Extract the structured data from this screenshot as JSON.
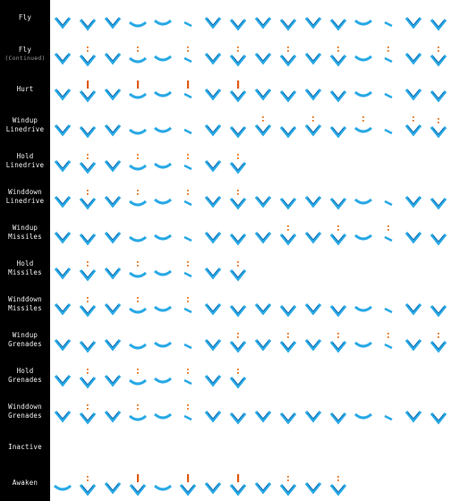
{
  "sheet": {
    "title": ""
  },
  "colors": {
    "sprite": "#29a9e6",
    "sprite_shadow": "#156fb0",
    "missile": "#e8741c",
    "grenade": "#d9a51a",
    "hurt": "#e05a10"
  },
  "rows": [
    {
      "label": [
        "Fly"
      ],
      "frames": 16,
      "shapes": [
        "v",
        "v",
        "v",
        "arc",
        "arc",
        "dash",
        "v",
        "v",
        "v",
        "v",
        "v",
        "v",
        "arc",
        "dash",
        "v",
        "v"
      ],
      "marks": []
    },
    {
      "label": [
        "Fly",
        "(Continued)"
      ],
      "frames": 16,
      "shapes": [
        "v",
        "v",
        "v",
        "arc",
        "arc",
        "dash",
        "v",
        "v",
        "v",
        "v",
        "v",
        "v",
        "arc",
        "dash",
        "v",
        "v"
      ],
      "marks": [
        [
          1,
          "spark"
        ],
        [
          3,
          "spark"
        ],
        [
          5,
          "spark"
        ],
        [
          7,
          "spark"
        ],
        [
          9,
          "spark"
        ],
        [
          11,
          "spark"
        ],
        [
          13,
          "spark"
        ],
        [
          15,
          "spark"
        ]
      ]
    },
    {
      "label": [
        "Hurt"
      ],
      "frames": 16,
      "shapes": [
        "v",
        "v",
        "v",
        "arc",
        "arc",
        "dash",
        "v",
        "v",
        "v",
        "v",
        "v",
        "v",
        "arc",
        "dash",
        "v",
        "v"
      ],
      "marks": [
        [
          1,
          "hurt"
        ],
        [
          3,
          "hurt"
        ],
        [
          5,
          "hurt"
        ],
        [
          7,
          "hurt"
        ]
      ]
    },
    {
      "label": [
        "Windup",
        "Linedrive"
      ],
      "frames": 16,
      "shapes": [
        "v",
        "v",
        "v",
        "arc",
        "arc",
        "dash",
        "v",
        "v",
        "v",
        "v",
        "v",
        "v",
        "arc",
        "dash",
        "v",
        "v"
      ],
      "marks": [
        [
          8,
          "spark"
        ],
        [
          10,
          "spark"
        ],
        [
          12,
          "spark"
        ],
        [
          14,
          "spark"
        ],
        [
          15,
          "spark"
        ]
      ]
    },
    {
      "label": [
        "Hold",
        "Linedrive"
      ],
      "frames": 8,
      "shapes": [
        "v",
        "v",
        "v",
        "arc",
        "arc",
        "dash",
        "v",
        "v"
      ],
      "marks": [
        [
          1,
          "spark"
        ],
        [
          3,
          "spark"
        ],
        [
          5,
          "spark"
        ],
        [
          7,
          "spark"
        ]
      ]
    },
    {
      "label": [
        "Winddown",
        "Linedrive"
      ],
      "frames": 16,
      "shapes": [
        "v",
        "v",
        "v",
        "arc",
        "arc",
        "dash",
        "v",
        "v",
        "v",
        "v",
        "v",
        "v",
        "arc",
        "dash",
        "v",
        "v"
      ],
      "marks": [
        [
          1,
          "spark"
        ],
        [
          3,
          "spark"
        ],
        [
          5,
          "spark"
        ],
        [
          7,
          "spark"
        ]
      ]
    },
    {
      "label": [
        "Windup",
        "Missiles"
      ],
      "frames": 16,
      "shapes": [
        "v",
        "v",
        "v",
        "arc",
        "arc",
        "dash",
        "v",
        "v",
        "v",
        "v",
        "v",
        "v",
        "arc",
        "dash",
        "v",
        "v"
      ],
      "marks": [
        [
          9,
          "spark"
        ],
        [
          11,
          "spark"
        ],
        [
          13,
          "spark"
        ]
      ]
    },
    {
      "label": [
        "Hold",
        "Missiles"
      ],
      "frames": 8,
      "shapes": [
        "v",
        "v",
        "v",
        "arc",
        "arc",
        "dash",
        "v",
        "v"
      ],
      "marks": [
        [
          1,
          "spark"
        ],
        [
          3,
          "spark"
        ],
        [
          5,
          "spark"
        ],
        [
          7,
          "spark"
        ]
      ]
    },
    {
      "label": [
        "Winddown",
        "Missiles"
      ],
      "frames": 16,
      "shapes": [
        "v",
        "v",
        "v",
        "arc",
        "arc",
        "dash",
        "v",
        "v",
        "v",
        "v",
        "v",
        "v",
        "arc",
        "dash",
        "v",
        "v"
      ],
      "marks": [
        [
          1,
          "spark"
        ],
        [
          3,
          "spark"
        ],
        [
          5,
          "spark"
        ]
      ]
    },
    {
      "label": [
        "Windup",
        "Grenades"
      ],
      "frames": 16,
      "shapes": [
        "v",
        "v",
        "v",
        "arc",
        "arc",
        "dash",
        "v",
        "v",
        "v",
        "v",
        "v",
        "v",
        "arc",
        "dash",
        "v",
        "v"
      ],
      "marks": [
        [
          7,
          "spark"
        ],
        [
          9,
          "spark"
        ],
        [
          11,
          "spark"
        ],
        [
          13,
          "spark"
        ],
        [
          15,
          "spark"
        ]
      ]
    },
    {
      "label": [
        "Hold",
        "Grenades"
      ],
      "frames": 8,
      "shapes": [
        "v",
        "v",
        "v",
        "arc",
        "arc",
        "dash",
        "v",
        "v"
      ],
      "marks": [
        [
          1,
          "spark"
        ],
        [
          3,
          "spark"
        ],
        [
          5,
          "spark"
        ],
        [
          7,
          "spark"
        ]
      ]
    },
    {
      "label": [
        "Winddown",
        "Grenades"
      ],
      "frames": 16,
      "shapes": [
        "v",
        "v",
        "v",
        "arc",
        "arc",
        "dash",
        "v",
        "v",
        "v",
        "v",
        "v",
        "v",
        "arc",
        "dash",
        "v",
        "v"
      ],
      "marks": [
        [
          1,
          "spark"
        ],
        [
          3,
          "spark"
        ],
        [
          5,
          "spark"
        ]
      ]
    },
    {
      "label": [
        "Inactive"
      ],
      "frames": 0,
      "shapes": [],
      "marks": []
    },
    {
      "label": [
        "Awaken"
      ],
      "frames": 12,
      "shapes": [
        "arc",
        "v",
        "v",
        "v",
        "arc",
        "v",
        "v",
        "v",
        "v",
        "v",
        "v",
        "v"
      ],
      "marks": [
        [
          1,
          "spark"
        ],
        [
          3,
          "hurt"
        ],
        [
          5,
          "hurt"
        ],
        [
          7,
          "hurt"
        ],
        [
          9,
          "spark"
        ],
        [
          11,
          "spark"
        ]
      ]
    }
  ]
}
